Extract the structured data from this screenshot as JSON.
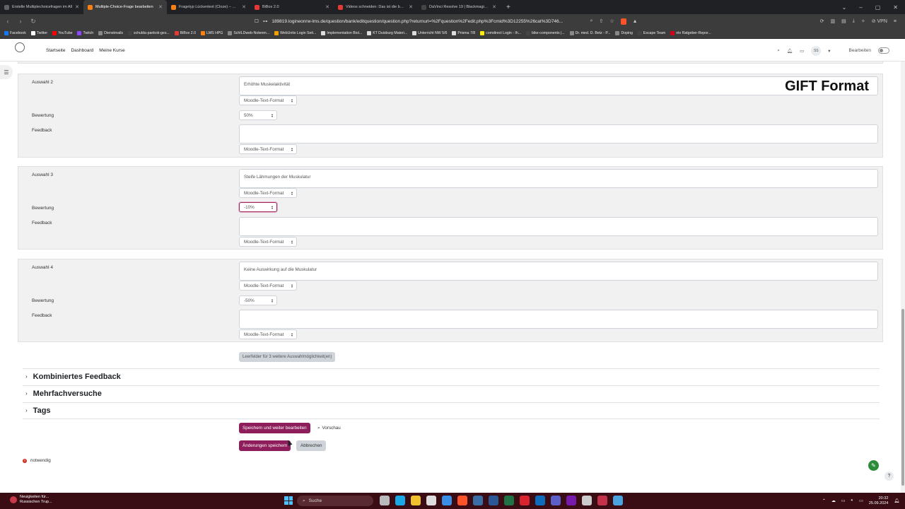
{
  "browser": {
    "tabs": [
      {
        "label": "Erstelle Multiplechoicefragen im All",
        "active": false,
        "color": "#5f6368"
      },
      {
        "label": "Multiple-Choice-Frage bearbeiten",
        "active": true,
        "color": "#f98012"
      },
      {
        "label": "Fragetyp Lückentext (Cloze) – Moo",
        "active": false,
        "color": "#f98012"
      },
      {
        "label": "BiBox 2.0",
        "active": false,
        "color": "#e53935"
      },
      {
        "label": "Videos schneiden: Das ist die beste",
        "active": false,
        "color": "#e53935"
      },
      {
        "label": "DaVinci Resolve 19 | Blackmagic De",
        "active": false,
        "color": "#444444"
      }
    ],
    "url": "189819.logineonrw-lms.de/question/bank/editquestion/question.php?returnurl=%2Fquestion%2Fedit.php%3Fcmid%3D12255%26cat%3D746...",
    "vpn_label": "VPN",
    "bookmarks": [
      {
        "label": "Facebook",
        "color": "#1877f2"
      },
      {
        "label": "Twitter",
        "color": "#ffffff"
      },
      {
        "label": "YouTube",
        "color": "#ff0000"
      },
      {
        "label": "Twitch",
        "color": "#9146ff"
      },
      {
        "label": "Dienstmails",
        "color": "#888888"
      },
      {
        "label": "schulda-pankok-ges...",
        "color": "#444444"
      },
      {
        "label": "BiBox 2.0",
        "color": "#e53935"
      },
      {
        "label": "LMS HPG",
        "color": "#f98012"
      },
      {
        "label": "SchILDweb-Notenm...",
        "color": "#888888"
      },
      {
        "label": "WebUntis Login Seit...",
        "color": "#f2a100"
      },
      {
        "label": "Implementation Biol...",
        "color": "#dddddd"
      },
      {
        "label": "KT Duisburg Materi...",
        "color": "#dddddd"
      },
      {
        "label": "Unterricht NW 5/6",
        "color": "#dddddd"
      },
      {
        "label": "Prisma 7/8",
        "color": "#dddddd"
      },
      {
        "label": "comdirect Login - Ih...",
        "color": "#fff000"
      },
      {
        "label": "bike-components |...",
        "color": "#444444"
      },
      {
        "label": "Dr. med. D. Betz - P...",
        "color": "#888888"
      },
      {
        "label": "Doping",
        "color": "#888888"
      },
      {
        "label": "Escape Team",
        "color": "#444444"
      },
      {
        "label": "ntv Ratgeber-Repor...",
        "color": "#d0021b"
      }
    ]
  },
  "header": {
    "nav": [
      "Startseite",
      "Dashboard",
      "Meine Kurse"
    ],
    "avatar_initials": "SS",
    "edit_mode_label": "Bearbeiten"
  },
  "overlay_title": "GIFT Format",
  "answers": [
    {
      "label": "Auswahl 2",
      "text": "Erhöhte Muskelaktivität",
      "format": "Moodle-Text-Format",
      "grade_label": "Bewertung",
      "grade": "50%",
      "feedback_label": "Feedback",
      "feedback_format": "Moodle-Text-Format",
      "focused": false
    },
    {
      "label": "Auswahl 3",
      "text": "Steife Lähmungen der Muskulatur",
      "format": "Moodle-Text-Format",
      "grade_label": "Bewertung",
      "grade": "-10%",
      "feedback_label": "Feedback",
      "feedback_format": "Moodle-Text-Format",
      "focused": true
    },
    {
      "label": "Auswahl 4",
      "text": "Keine Auswirkung auf die Muskulatur",
      "format": "Moodle-Text-Format",
      "grade_label": "Bewertung",
      "grade": "-50%",
      "feedback_label": "Feedback",
      "feedback_format": "Moodle-Text-Format",
      "focused": false
    }
  ],
  "blanks_button": "Leerfelder für 3 weitere Auswahlmöglichkeit(en)",
  "sections": [
    "Kombiniertes Feedback",
    "Mehrfachversuche",
    "Tags"
  ],
  "actions": {
    "save_continue": "Speichern und weiter bearbeiten",
    "preview": "Vorschau",
    "save": "Änderungen speichern",
    "cancel": "Abbrechen"
  },
  "required_note": "notwendig",
  "taskbar": {
    "news_title": "Neuigkeiten für...",
    "news_sub": "Russischen Trup...",
    "search_placeholder": "Suche",
    "time": "20:32",
    "date": "25.09.2024",
    "apps": [
      {
        "name": "task-view",
        "color": "#bbbbbb"
      },
      {
        "name": "edge",
        "color": "#1aa8e6"
      },
      {
        "name": "explorer",
        "color": "#f2c12e"
      },
      {
        "name": "photos",
        "color": "#dddddd"
      },
      {
        "name": "mail",
        "color": "#3a8ee6"
      },
      {
        "name": "brave",
        "color": "#fb542b"
      },
      {
        "name": "app",
        "color": "#3a6ea5"
      },
      {
        "name": "word",
        "color": "#2b5797"
      },
      {
        "name": "excel",
        "color": "#1f7244"
      },
      {
        "name": "acrobat",
        "color": "#d9232e"
      },
      {
        "name": "outlook",
        "color": "#0f6cbd"
      },
      {
        "name": "teams",
        "color": "#5b5fc7"
      },
      {
        "name": "onenote",
        "color": "#7719aa"
      },
      {
        "name": "obs",
        "color": "#cccccc"
      },
      {
        "name": "davinci",
        "color": "#c4314b"
      },
      {
        "name": "notepad",
        "color": "#4aa3df"
      }
    ]
  }
}
